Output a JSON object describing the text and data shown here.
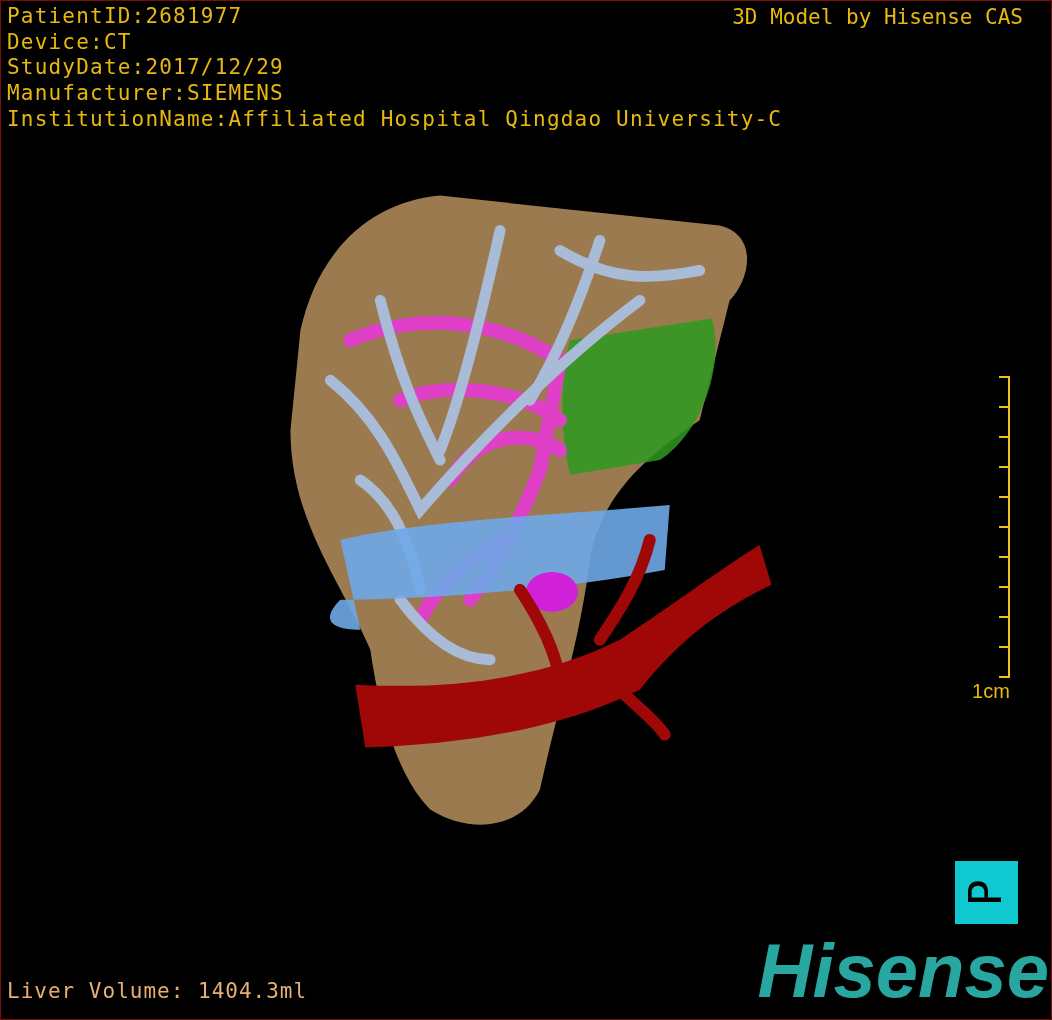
{
  "info_lines": [
    "PatientID:2681977",
    "Device:CT",
    "StudyDate:2017/12/29",
    "Manufacturer:SIEMENS",
    "InstitutionName:Affiliated Hospital Qingdao University-C"
  ],
  "title": "3D Model by Hisense CAS",
  "scale_bar": {
    "label": "1cm"
  },
  "orientation_marker": {
    "label": "P"
  },
  "logo": "Hisense",
  "liver_volume": "Liver Volume: 1404.3ml"
}
